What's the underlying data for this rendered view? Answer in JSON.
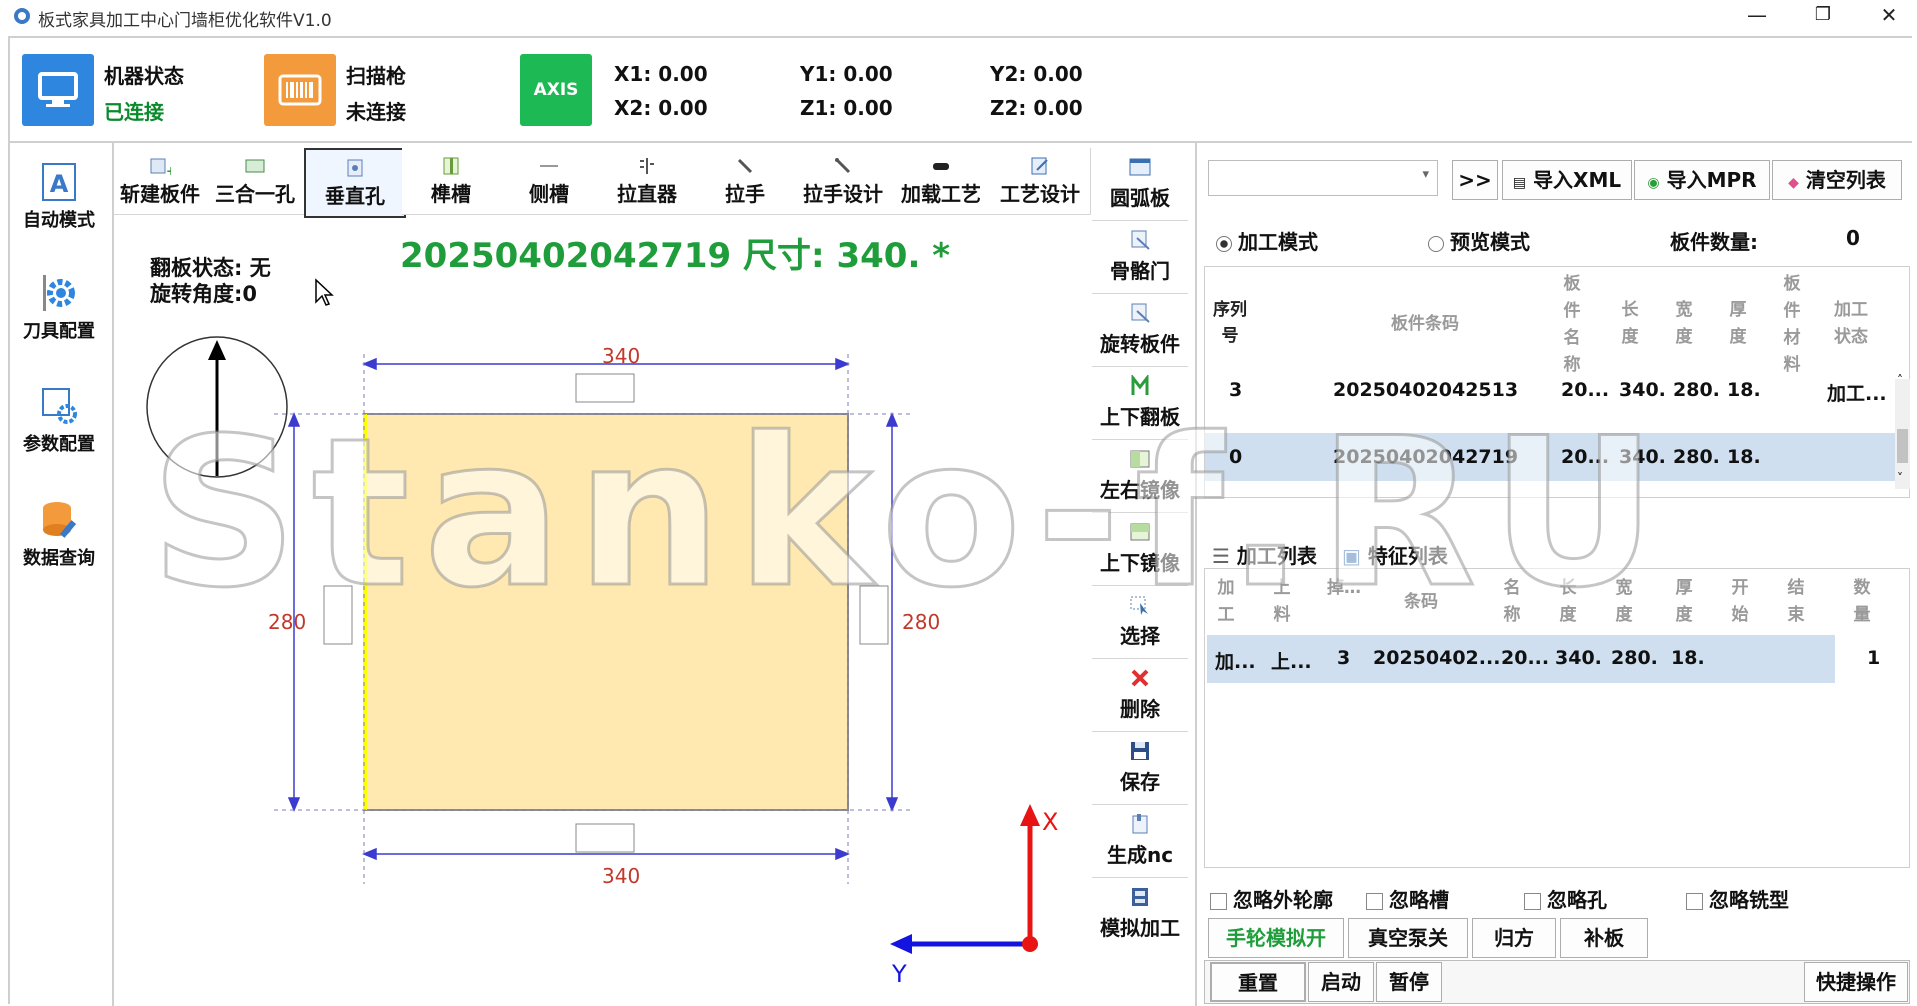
{
  "window": {
    "title": "板式家具加工中心门墙柜优化软件V1.0",
    "min": "—",
    "restore": "❐",
    "close": "✕"
  },
  "status": {
    "machine_label": "机器状态",
    "machine_value": "已连接",
    "scanner_label": "扫描枪",
    "scanner_value": "未连接",
    "axis_badge": "AXIS",
    "x1": "X1:  0.00",
    "x2": "X2:  0.00",
    "y1": "Y1:  0.00",
    "z1": "Z1:  0.00",
    "y2": "Y2:  0.00",
    "z2": "Z2:  0.00",
    "colors": {
      "machine_box": "#2e86de",
      "scanner_box": "#f39a3c",
      "axis_box": "#1db954",
      "connected_text": "#0a8a2a"
    }
  },
  "nav": [
    {
      "label": "自动模式",
      "icon": "auto-mode-icon"
    },
    {
      "label": "刀具配置",
      "icon": "tool-gear-icon"
    },
    {
      "label": "参数配置",
      "icon": "param-config-icon"
    },
    {
      "label": "数据查询",
      "icon": "database-icon"
    }
  ],
  "toolbar": [
    "斩建板件",
    "三合一孔",
    "垂直孔",
    "榫槽",
    "侧槽",
    "拉直器",
    "拉手",
    "拉手设计",
    "加载工艺",
    "工艺设计"
  ],
  "vtoolbar": [
    "圆弧板",
    "骨骼门",
    "旋转板件",
    "上下翻板",
    "左右镜像",
    "上下镜像",
    "选择",
    "删除",
    "保存",
    "生成nc",
    "模拟加工"
  ],
  "canvas": {
    "info_line1": "翻板状态: 无",
    "info_line2": "旋转角度:0",
    "heading": "20250402042719  尺寸: 340. *",
    "dim_top": "340",
    "dim_bottom": "340",
    "dim_left": "280",
    "dim_right": "280",
    "axis_x": "X",
    "axis_y": "Y",
    "watermark": "Stanko-f.RU",
    "colors": {
      "board_fill": "#ffe9b0",
      "heading": "#1f9d3a",
      "dim_text": "#c0392b"
    }
  },
  "right": {
    "import_xml": "导入XML",
    "import_mpr": "导入MPR",
    "clear_list": "清空列表",
    "arrow_btn": ">>",
    "mode_process": "加工模式",
    "mode_preview": "预览模式",
    "board_count_label": "板件数量:",
    "board_count_value": "0",
    "table1": {
      "headers": [
        "序列号",
        "板件条码",
        "板件名称",
        "长度",
        "宽度",
        "厚度",
        "板件材料",
        "加工状态"
      ],
      "rows": [
        {
          "seq": "3",
          "code": "20250402042513",
          "name": "20...",
          "len": "340.",
          "wid": "280.",
          "thk": "18.",
          "mat": "",
          "state": "加工..."
        },
        {
          "seq": "0",
          "code": "20250402042719",
          "name": "20...",
          "len": "340.",
          "wid": "280.",
          "thk": "18.",
          "mat": "",
          "state": ""
        }
      ]
    },
    "tab_process": "加工列表",
    "tab_feature": "特征列表",
    "table2": {
      "headers": [
        "加工",
        "上料",
        "掉…",
        "条码",
        "名称",
        "长度",
        "宽度",
        "厚度",
        "开始",
        "结束",
        "数量"
      ],
      "row": {
        "proc": "加...",
        "load": "上...",
        "seq": "3",
        "code": "20250402...",
        "name": "20...",
        "len": "340.",
        "wid": "280.",
        "thk": "18.",
        "qty": "1"
      }
    },
    "checks": [
      "忽略外轮廓",
      "忽略槽",
      "忽略孔",
      "忽略铣型"
    ],
    "buttons1": [
      "手轮模拟开",
      "真空泵关",
      "归方",
      "补板"
    ],
    "buttons2": [
      "重置",
      "启动",
      "暂停"
    ],
    "quick_ops": "快捷操作"
  }
}
